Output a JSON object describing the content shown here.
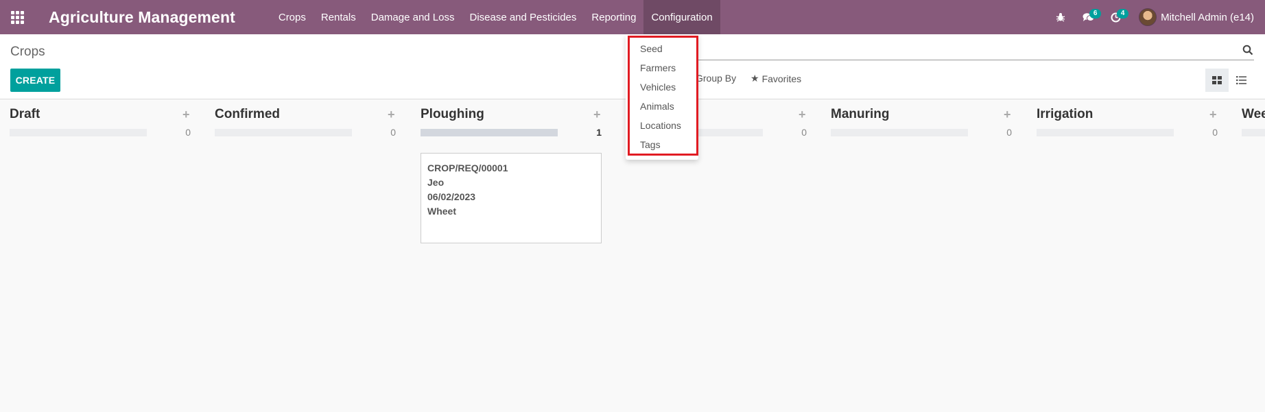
{
  "app": {
    "title": "Agriculture Management"
  },
  "menu": {
    "items": [
      {
        "label": "Crops"
      },
      {
        "label": "Rentals"
      },
      {
        "label": "Damage and Loss"
      },
      {
        "label": "Disease and Pesticides"
      },
      {
        "label": "Reporting"
      },
      {
        "label": "Configuration"
      }
    ]
  },
  "systray": {
    "messages_count": "6",
    "activities_count": "4",
    "user_name": "Mitchell Admin (e14)"
  },
  "control_panel": {
    "breadcrumb": "Crops",
    "create_label": "CREATE",
    "group_by_label": "Group By",
    "favorites_label": "Favorites"
  },
  "config_dropdown": {
    "items": [
      {
        "label": "Seed"
      },
      {
        "label": "Farmers"
      },
      {
        "label": "Vehicles"
      },
      {
        "label": "Animals"
      },
      {
        "label": "Locations"
      },
      {
        "label": "Tags"
      }
    ]
  },
  "kanban": {
    "columns": [
      {
        "title": "Draft",
        "count": "0"
      },
      {
        "title": "Confirmed",
        "count": "0"
      },
      {
        "title": "Ploughing",
        "count": "1"
      },
      {
        "title": "",
        "count": "0"
      },
      {
        "title": "Manuring",
        "count": "0"
      },
      {
        "title": "Irrigation",
        "count": "0"
      },
      {
        "title": "Wee",
        "count": ""
      }
    ],
    "card": {
      "reference": "CROP/REQ/00001",
      "farmer": "Jeo",
      "date": "06/02/2023",
      "crop": "Wheet"
    }
  },
  "colors": {
    "navbar": "#875a7b",
    "accent": "#00a09d",
    "highlight": "#e11b22"
  }
}
